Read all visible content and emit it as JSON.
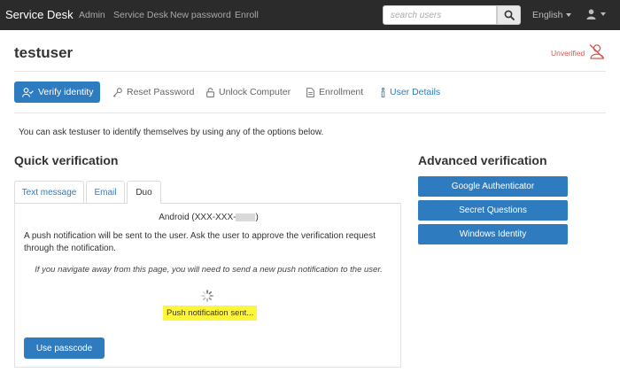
{
  "navbar": {
    "brand": "Service Desk",
    "links": [
      "Admin",
      "Service Desk",
      "New password",
      "Enroll"
    ],
    "search_placeholder": "search users",
    "language": "English"
  },
  "header": {
    "title": "testuser",
    "status": "Unverified"
  },
  "tabs": [
    {
      "label": "Verify identity",
      "active": true
    },
    {
      "label": "Reset Password"
    },
    {
      "label": "Unlock Computer"
    },
    {
      "label": "Enrollment"
    },
    {
      "label": "User Details"
    }
  ],
  "intro_text": "You can ask testuser to identify themselves by using any of the options below.",
  "quick": {
    "title": "Quick verification",
    "tabs": [
      "Text message",
      "Email",
      "Duo"
    ],
    "active_tab": "Duo",
    "device": "Android (XXX-XXX-",
    "device_suffix": ")",
    "description": "A push notification will be sent to the user. Ask the user to approve the verification request through the notification.",
    "warning": "If you navigate away from this page, you will need to send a new push notification to the user.",
    "status": "Push notification sent...",
    "passcode_button": "Use passcode"
  },
  "advanced": {
    "title": "Advanced verification",
    "buttons": [
      "Google Authenticator",
      "Secret Questions",
      "Windows Identity"
    ]
  },
  "colors": {
    "navbar_bg": "#2b2b2b",
    "primary": "#2f7bbf",
    "danger": "#d9534f",
    "highlight": "#fff53d"
  }
}
